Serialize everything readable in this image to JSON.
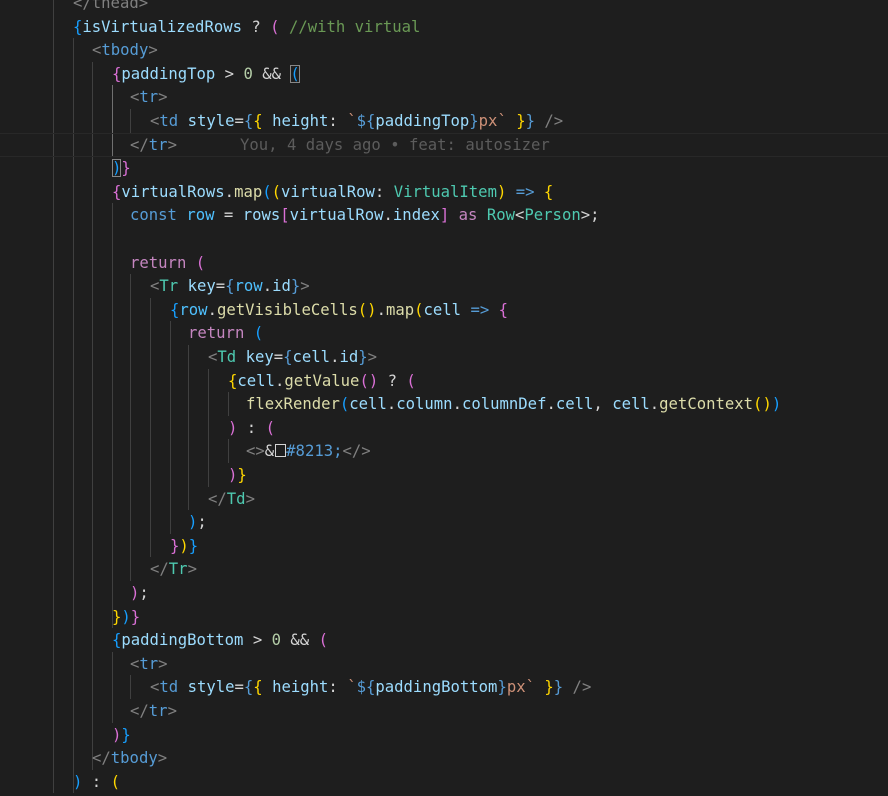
{
  "colors": {
    "background": "#1e1e1e",
    "guide": "#404040",
    "guide_active": "#707070",
    "current_line_border": "#282828"
  },
  "lines": [
    {
      "tokens": [
        {
          "t": "</thead>",
          "c": "#808080"
        }
      ]
    },
    {
      "tokens": [
        {
          "t": "{",
          "c": "#179fff"
        },
        {
          "t": "isVirtualizedRows",
          "c": "#9cdcfe"
        },
        {
          "t": " ? ",
          "c": "#d4d4d4"
        },
        {
          "t": "(",
          "c": "#da70d6"
        },
        {
          "t": " //with virtual",
          "c": "#6a9955"
        }
      ]
    },
    {
      "tokens": [
        {
          "t": "<",
          "c": "#808080"
        },
        {
          "t": "tbody",
          "c": "#569cd6"
        },
        {
          "t": ">",
          "c": "#808080"
        }
      ]
    },
    {
      "tokens": [
        {
          "t": "{",
          "c": "#da70d6"
        },
        {
          "t": "paddingTop",
          "c": "#9cdcfe"
        },
        {
          "t": " > ",
          "c": "#d4d4d4"
        },
        {
          "t": "0",
          "c": "#b5cea8"
        },
        {
          "t": " && ",
          "c": "#d4d4d4"
        },
        {
          "t": "(",
          "c": "#179fff",
          "box": true
        }
      ]
    },
    {
      "tokens": [
        {
          "t": "<",
          "c": "#808080"
        },
        {
          "t": "tr",
          "c": "#569cd6"
        },
        {
          "t": ">",
          "c": "#808080"
        }
      ]
    },
    {
      "tokens": [
        {
          "t": "<",
          "c": "#808080"
        },
        {
          "t": "td",
          "c": "#569cd6"
        },
        {
          "t": " ",
          "c": "#d4d4d4"
        },
        {
          "t": "style",
          "c": "#9cdcfe"
        },
        {
          "t": "=",
          "c": "#d4d4d4"
        },
        {
          "t": "{",
          "c": "#569cd6"
        },
        {
          "t": "{",
          "c": "#ffd700"
        },
        {
          "t": " ",
          "c": "#d4d4d4"
        },
        {
          "t": "height",
          "c": "#9cdcfe"
        },
        {
          "t": ": ",
          "c": "#d4d4d4"
        },
        {
          "t": "`",
          "c": "#ce9178"
        },
        {
          "t": "${",
          "c": "#569cd6"
        },
        {
          "t": "paddingTop",
          "c": "#9cdcfe"
        },
        {
          "t": "}",
          "c": "#569cd6"
        },
        {
          "t": "px",
          "c": "#ce9178"
        },
        {
          "t": "`",
          "c": "#ce9178"
        },
        {
          "t": " ",
          "c": "#d4d4d4"
        },
        {
          "t": "}",
          "c": "#ffd700"
        },
        {
          "t": "}",
          "c": "#569cd6"
        },
        {
          "t": " />",
          "c": "#808080"
        }
      ]
    },
    {
      "tokens": [
        {
          "t": "</",
          "c": "#808080"
        },
        {
          "t": "tr",
          "c": "#569cd6"
        },
        {
          "t": ">",
          "c": "#808080"
        }
      ],
      "blame": "You, 4 days ago • feat: autosizer"
    },
    {
      "tokens": [
        {
          "t": ")",
          "c": "#179fff",
          "box": true
        },
        {
          "t": "}",
          "c": "#da70d6"
        }
      ]
    },
    {
      "tokens": [
        {
          "t": "{",
          "c": "#da70d6"
        },
        {
          "t": "virtualRows",
          "c": "#9cdcfe"
        },
        {
          "t": ".",
          "c": "#d4d4d4"
        },
        {
          "t": "map",
          "c": "#dcdcaa"
        },
        {
          "t": "(",
          "c": "#179fff"
        },
        {
          "t": "(",
          "c": "#ffd700"
        },
        {
          "t": "virtualRow",
          "c": "#9cdcfe"
        },
        {
          "t": ": ",
          "c": "#d4d4d4"
        },
        {
          "t": "VirtualItem",
          "c": "#4ec9b0"
        },
        {
          "t": ")",
          "c": "#ffd700"
        },
        {
          "t": " => ",
          "c": "#569cd6"
        },
        {
          "t": "{",
          "c": "#ffd700"
        }
      ]
    },
    {
      "tokens": [
        {
          "t": "const",
          "c": "#569cd6"
        },
        {
          "t": " ",
          "c": "#d4d4d4"
        },
        {
          "t": "row",
          "c": "#4fc1ff"
        },
        {
          "t": " = ",
          "c": "#d4d4d4"
        },
        {
          "t": "rows",
          "c": "#9cdcfe"
        },
        {
          "t": "[",
          "c": "#da70d6"
        },
        {
          "t": "virtualRow",
          "c": "#9cdcfe"
        },
        {
          "t": ".",
          "c": "#d4d4d4"
        },
        {
          "t": "index",
          "c": "#9cdcfe"
        },
        {
          "t": "]",
          "c": "#da70d6"
        },
        {
          "t": " ",
          "c": "#d4d4d4"
        },
        {
          "t": "as",
          "c": "#c586c0"
        },
        {
          "t": " ",
          "c": "#d4d4d4"
        },
        {
          "t": "Row",
          "c": "#4ec9b0"
        },
        {
          "t": "<",
          "c": "#d4d4d4"
        },
        {
          "t": "Person",
          "c": "#4ec9b0"
        },
        {
          "t": ">;",
          "c": "#d4d4d4"
        }
      ]
    },
    {
      "tokens": []
    },
    {
      "tokens": [
        {
          "t": "return",
          "c": "#c586c0"
        },
        {
          "t": " ",
          "c": "#d4d4d4"
        },
        {
          "t": "(",
          "c": "#da70d6"
        }
      ]
    },
    {
      "tokens": [
        {
          "t": "<",
          "c": "#808080"
        },
        {
          "t": "Tr",
          "c": "#4ec9b0"
        },
        {
          "t": " ",
          "c": "#d4d4d4"
        },
        {
          "t": "key",
          "c": "#9cdcfe"
        },
        {
          "t": "=",
          "c": "#d4d4d4"
        },
        {
          "t": "{",
          "c": "#569cd6"
        },
        {
          "t": "row",
          "c": "#4fc1ff"
        },
        {
          "t": ".",
          "c": "#d4d4d4"
        },
        {
          "t": "id",
          "c": "#9cdcfe"
        },
        {
          "t": "}",
          "c": "#569cd6"
        },
        {
          "t": ">",
          "c": "#808080"
        }
      ]
    },
    {
      "tokens": [
        {
          "t": "{",
          "c": "#179fff"
        },
        {
          "t": "row",
          "c": "#4fc1ff"
        },
        {
          "t": ".",
          "c": "#d4d4d4"
        },
        {
          "t": "getVisibleCells",
          "c": "#dcdcaa"
        },
        {
          "t": "(",
          "c": "#ffd700"
        },
        {
          "t": ")",
          "c": "#ffd700"
        },
        {
          "t": ".",
          "c": "#d4d4d4"
        },
        {
          "t": "map",
          "c": "#dcdcaa"
        },
        {
          "t": "(",
          "c": "#ffd700"
        },
        {
          "t": "cell",
          "c": "#9cdcfe"
        },
        {
          "t": " => ",
          "c": "#569cd6"
        },
        {
          "t": "{",
          "c": "#da70d6"
        }
      ]
    },
    {
      "tokens": [
        {
          "t": "return",
          "c": "#c586c0"
        },
        {
          "t": " ",
          "c": "#d4d4d4"
        },
        {
          "t": "(",
          "c": "#179fff"
        }
      ]
    },
    {
      "tokens": [
        {
          "t": "<",
          "c": "#808080"
        },
        {
          "t": "Td",
          "c": "#4ec9b0"
        },
        {
          "t": " ",
          "c": "#d4d4d4"
        },
        {
          "t": "key",
          "c": "#9cdcfe"
        },
        {
          "t": "=",
          "c": "#d4d4d4"
        },
        {
          "t": "{",
          "c": "#569cd6"
        },
        {
          "t": "cell",
          "c": "#9cdcfe"
        },
        {
          "t": ".",
          "c": "#d4d4d4"
        },
        {
          "t": "id",
          "c": "#9cdcfe"
        },
        {
          "t": "}",
          "c": "#569cd6"
        },
        {
          "t": ">",
          "c": "#808080"
        }
      ]
    },
    {
      "tokens": [
        {
          "t": "{",
          "c": "#ffd700"
        },
        {
          "t": "cell",
          "c": "#9cdcfe"
        },
        {
          "t": ".",
          "c": "#d4d4d4"
        },
        {
          "t": "getValue",
          "c": "#dcdcaa"
        },
        {
          "t": "(",
          "c": "#da70d6"
        },
        {
          "t": ")",
          "c": "#da70d6"
        },
        {
          "t": " ? ",
          "c": "#d4d4d4"
        },
        {
          "t": "(",
          "c": "#da70d6"
        }
      ]
    },
    {
      "tokens": [
        {
          "t": "flexRender",
          "c": "#dcdcaa"
        },
        {
          "t": "(",
          "c": "#179fff"
        },
        {
          "t": "cell",
          "c": "#9cdcfe"
        },
        {
          "t": ".",
          "c": "#d4d4d4"
        },
        {
          "t": "column",
          "c": "#9cdcfe"
        },
        {
          "t": ".",
          "c": "#d4d4d4"
        },
        {
          "t": "columnDef",
          "c": "#9cdcfe"
        },
        {
          "t": ".",
          "c": "#d4d4d4"
        },
        {
          "t": "cell",
          "c": "#9cdcfe"
        },
        {
          "t": ", ",
          "c": "#d4d4d4"
        },
        {
          "t": "cell",
          "c": "#9cdcfe"
        },
        {
          "t": ".",
          "c": "#d4d4d4"
        },
        {
          "t": "getContext",
          "c": "#dcdcaa"
        },
        {
          "t": "(",
          "c": "#ffd700"
        },
        {
          "t": ")",
          "c": "#ffd700"
        },
        {
          "t": ")",
          "c": "#179fff"
        }
      ]
    },
    {
      "tokens": [
        {
          "t": ")",
          "c": "#da70d6"
        },
        {
          "t": " : ",
          "c": "#d4d4d4"
        },
        {
          "t": "(",
          "c": "#da70d6"
        }
      ]
    },
    {
      "tokens": [
        {
          "t": "<>",
          "c": "#808080"
        },
        {
          "t": "&",
          "c": "#d4d4d4"
        },
        {
          "t": "",
          "c": "#d4d4d4",
          "boxchar": true
        },
        {
          "t": "#8213;",
          "c": "#569cd6"
        },
        {
          "t": "</>",
          "c": "#808080"
        }
      ]
    },
    {
      "tokens": [
        {
          "t": ")",
          "c": "#da70d6"
        },
        {
          "t": "}",
          "c": "#ffd700"
        }
      ]
    },
    {
      "tokens": [
        {
          "t": "</",
          "c": "#808080"
        },
        {
          "t": "Td",
          "c": "#4ec9b0"
        },
        {
          "t": ">",
          "c": "#808080"
        }
      ]
    },
    {
      "tokens": [
        {
          "t": ")",
          "c": "#179fff"
        },
        {
          "t": ";",
          "c": "#d4d4d4"
        }
      ]
    },
    {
      "tokens": [
        {
          "t": "}",
          "c": "#da70d6"
        },
        {
          "t": ")",
          "c": "#ffd700"
        },
        {
          "t": "}",
          "c": "#179fff"
        }
      ]
    },
    {
      "tokens": [
        {
          "t": "</",
          "c": "#808080"
        },
        {
          "t": "Tr",
          "c": "#4ec9b0"
        },
        {
          "t": ">",
          "c": "#808080"
        }
      ]
    },
    {
      "tokens": [
        {
          "t": ")",
          "c": "#da70d6"
        },
        {
          "t": ";",
          "c": "#d4d4d4"
        }
      ]
    },
    {
      "tokens": [
        {
          "t": "}",
          "c": "#ffd700"
        },
        {
          "t": ")",
          "c": "#179fff"
        },
        {
          "t": "}",
          "c": "#da70d6"
        }
      ]
    },
    {
      "tokens": [
        {
          "t": "{",
          "c": "#179fff"
        },
        {
          "t": "paddingBottom",
          "c": "#9cdcfe"
        },
        {
          "t": " > ",
          "c": "#d4d4d4"
        },
        {
          "t": "0",
          "c": "#b5cea8"
        },
        {
          "t": " && ",
          "c": "#d4d4d4"
        },
        {
          "t": "(",
          "c": "#da70d6"
        }
      ]
    },
    {
      "tokens": [
        {
          "t": "<",
          "c": "#808080"
        },
        {
          "t": "tr",
          "c": "#569cd6"
        },
        {
          "t": ">",
          "c": "#808080"
        }
      ]
    },
    {
      "tokens": [
        {
          "t": "<",
          "c": "#808080"
        },
        {
          "t": "td",
          "c": "#569cd6"
        },
        {
          "t": " ",
          "c": "#d4d4d4"
        },
        {
          "t": "style",
          "c": "#9cdcfe"
        },
        {
          "t": "=",
          "c": "#d4d4d4"
        },
        {
          "t": "{",
          "c": "#569cd6"
        },
        {
          "t": "{",
          "c": "#ffd700"
        },
        {
          "t": " ",
          "c": "#d4d4d4"
        },
        {
          "t": "height",
          "c": "#9cdcfe"
        },
        {
          "t": ": ",
          "c": "#d4d4d4"
        },
        {
          "t": "`",
          "c": "#ce9178"
        },
        {
          "t": "${",
          "c": "#569cd6"
        },
        {
          "t": "paddingBottom",
          "c": "#9cdcfe"
        },
        {
          "t": "}",
          "c": "#569cd6"
        },
        {
          "t": "px",
          "c": "#ce9178"
        },
        {
          "t": "`",
          "c": "#ce9178"
        },
        {
          "t": " ",
          "c": "#d4d4d4"
        },
        {
          "t": "}",
          "c": "#ffd700"
        },
        {
          "t": "}",
          "c": "#569cd6"
        },
        {
          "t": " />",
          "c": "#808080"
        }
      ]
    },
    {
      "tokens": [
        {
          "t": "</",
          "c": "#808080"
        },
        {
          "t": "tr",
          "c": "#569cd6"
        },
        {
          "t": ">",
          "c": "#808080"
        }
      ]
    },
    {
      "tokens": [
        {
          "t": ")",
          "c": "#da70d6"
        },
        {
          "t": "}",
          "c": "#179fff"
        }
      ]
    },
    {
      "tokens": [
        {
          "t": "</",
          "c": "#808080"
        },
        {
          "t": "tbody",
          "c": "#569cd6"
        },
        {
          "t": ">",
          "c": "#808080"
        }
      ]
    },
    {
      "tokens": [
        {
          "t": ")",
          "c": "#179fff"
        },
        {
          "t": " : ",
          "c": "#d4d4d4"
        },
        {
          "t": "(",
          "c": "#ffd700"
        }
      ]
    }
  ]
}
